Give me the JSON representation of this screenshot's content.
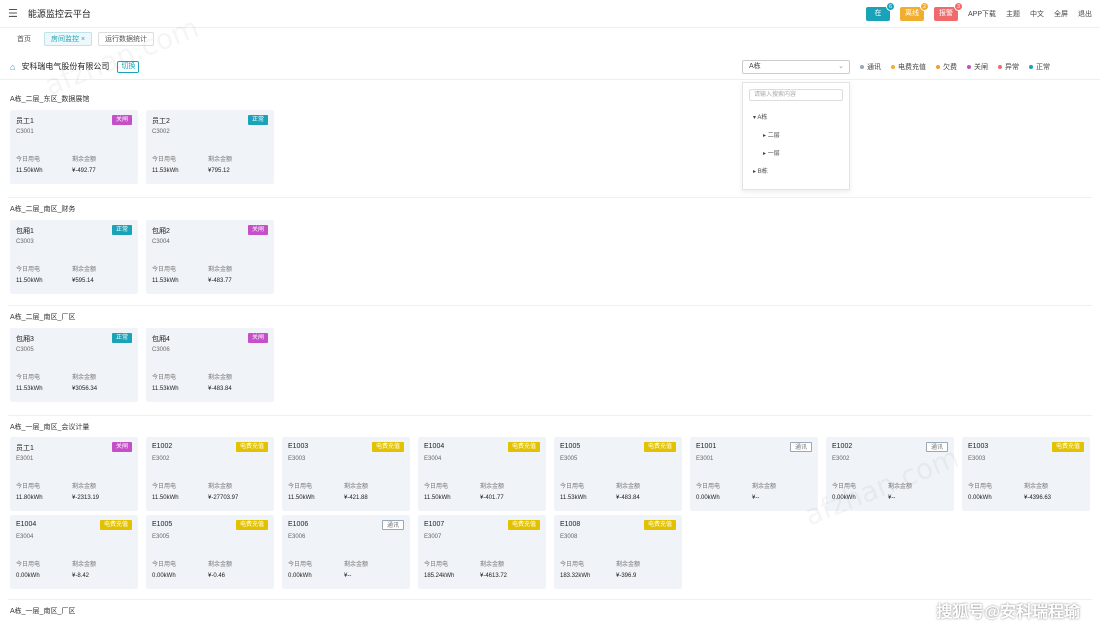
{
  "header": {
    "menu_icon": "menu-icon",
    "title": "能源监控云平台",
    "pills": [
      {
        "label": "在",
        "count": "6",
        "color": "#1aa3b8"
      },
      {
        "label": "离线",
        "count": "2",
        "color": "#f0ad2e"
      },
      {
        "label": "报警",
        "count": "3",
        "color": "#ef6b6b"
      }
    ],
    "links": [
      "APP下载",
      "主题",
      "中文",
      "全屏",
      "退出"
    ]
  },
  "tabs": [
    {
      "label": "首页",
      "state": "normal"
    },
    {
      "label": "房间监控 ×",
      "state": "active"
    },
    {
      "label": "运行数据统计",
      "state": "outline"
    }
  ],
  "company": {
    "name": "安科瑞电气股份有限公司",
    "switch_label": "切换",
    "select_value": "A栋",
    "legend": [
      {
        "label": "通讯",
        "color": "#9aa7b4"
      },
      {
        "label": "电费充值",
        "color": "#f0ad2e"
      },
      {
        "label": "欠费",
        "color": "#f39c34"
      },
      {
        "label": "关闸",
        "color": "#c44fc8"
      },
      {
        "label": "异常",
        "color": "#ef6b6b"
      },
      {
        "label": "正常",
        "color": "#1aa3b8"
      }
    ]
  },
  "dropdown": {
    "search_placeholder": "请输入搜索内容",
    "nodes": [
      {
        "label": "A栋",
        "level": 1
      },
      {
        "label": "二层",
        "level": 2
      },
      {
        "label": "一层",
        "level": 2
      },
      {
        "label": "B栋",
        "level": 1
      }
    ]
  },
  "groups": [
    {
      "title": "A栋_二层_东区_数据展馆",
      "cards": [
        {
          "name": "员工1",
          "code": "C3001",
          "badge": "关闸",
          "badge_color": "#c44fc8",
          "l1": "今日用电",
          "l2": "剩余金额",
          "v1": "11.50kWh",
          "v2": "¥-492.77"
        },
        {
          "name": "员工2",
          "code": "C3002",
          "badge": "正常",
          "badge_color": "#1aa3b8",
          "l1": "今日用电",
          "l2": "剩余金额",
          "v1": "11.53kWh",
          "v2": "¥795.12"
        }
      ]
    },
    {
      "title": "A栋_二层_南区_财务",
      "cards": [
        {
          "name": "包厢1",
          "code": "C3003",
          "badge": "正常",
          "badge_color": "#1aa3b8",
          "l1": "今日用电",
          "l2": "剩余金额",
          "v1": "11.50kWh",
          "v2": "¥595.14"
        },
        {
          "name": "包厢2",
          "code": "C3004",
          "badge": "关闸",
          "badge_color": "#c44fc8",
          "l1": "今日用电",
          "l2": "剩余金额",
          "v1": "11.53kWh",
          "v2": "¥-483.77"
        }
      ]
    },
    {
      "title": "A栋_二层_南区_厂区",
      "cards": [
        {
          "name": "包厢3",
          "code": "C3005",
          "badge": "正常",
          "badge_color": "#1aa3b8",
          "l1": "今日用电",
          "l2": "剩余金额",
          "v1": "11.53kWh",
          "v2": "¥3056.34"
        },
        {
          "name": "包厢4",
          "code": "C3006",
          "badge": "关闸",
          "badge_color": "#c44fc8",
          "l1": "今日用电",
          "l2": "剩余金额",
          "v1": "11.53kWh",
          "v2": "¥-483.84"
        }
      ]
    },
    {
      "title": "A栋_一层_南区_会议计量",
      "cards": [
        {
          "name": "员工1",
          "code": "E3001",
          "badge": "关闸",
          "badge_color": "#c44fc8",
          "l1": "今日用电",
          "l2": "剩余金额",
          "v1": "11.80kWh",
          "v2": "¥-2313.19"
        },
        {
          "name": "E1002",
          "code": "E3002",
          "badge": "电费充值",
          "badge_color": "#e2c200",
          "l1": "今日用电",
          "l2": "剩余金额",
          "v1": "11.50kWh",
          "v2": "¥-27703.97"
        },
        {
          "name": "E1003",
          "code": "E3003",
          "badge": "电费充值",
          "badge_color": "#e2c200",
          "l1": "今日用电",
          "l2": "剩余金额",
          "v1": "11.50kWh",
          "v2": "¥-421.88"
        },
        {
          "name": "E1004",
          "code": "E3004",
          "badge": "电费充值",
          "badge_color": "#e2c200",
          "l1": "今日用电",
          "l2": "剩余金额",
          "v1": "11.50kWh",
          "v2": "¥-401.77"
        },
        {
          "name": "E1005",
          "code": "E3005",
          "badge": "电费充值",
          "badge_color": "#e2c200",
          "l1": "今日用电",
          "l2": "剩余金额",
          "v1": "11.53kWh",
          "v2": "¥-483.84"
        },
        {
          "name": "E1001",
          "code": "E3001",
          "badge": "通讯",
          "badge_color": "#9aa7b4",
          "l1": "今日用电",
          "l2": "剩余金额",
          "v1": "0.00kWh",
          "v2": "¥--"
        },
        {
          "name": "E1002",
          "code": "E3002",
          "badge": "通讯",
          "badge_color": "#9aa7b4",
          "l1": "今日用电",
          "l2": "剩余金额",
          "v1": "0.00kWh",
          "v2": "¥--"
        },
        {
          "name": "E1003",
          "code": "E3003",
          "badge": "电费充值",
          "badge_color": "#e2c200",
          "l1": "今日用电",
          "l2": "剩余金额",
          "v1": "0.00kWh",
          "v2": "¥-4396.63"
        },
        {
          "name": "E1004",
          "code": "E3004",
          "badge": "电费充值",
          "badge_color": "#e2c200",
          "l1": "今日用电",
          "l2": "剩余金额",
          "v1": "0.00kWh",
          "v2": "¥-8.42"
        },
        {
          "name": "E1005",
          "code": "E3005",
          "badge": "电费充值",
          "badge_color": "#e2c200",
          "l1": "今日用电",
          "l2": "剩余金额",
          "v1": "0.00kWh",
          "v2": "¥-0.46"
        },
        {
          "name": "E1006",
          "code": "E3006",
          "badge": "通讯",
          "badge_color": "#9aa7b4",
          "l1": "今日用电",
          "l2": "剩余金额",
          "v1": "0.00kWh",
          "v2": "¥--"
        },
        {
          "name": "E1007",
          "code": "E3007",
          "badge": "电费充值",
          "badge_color": "#e2c200",
          "l1": "今日用电",
          "l2": "剩余金额",
          "v1": "185.24kWh",
          "v2": "¥-4613.72"
        },
        {
          "name": "E1008",
          "code": "E3008",
          "badge": "电费充值",
          "badge_color": "#e2c200",
          "l1": "今日用电",
          "l2": "剩余金额",
          "v1": "183.32kWh",
          "v2": "¥-396.9"
        }
      ]
    },
    {
      "title": "A栋_一层_南区_厂区",
      "cards": []
    }
  ],
  "overlay": {
    "source_tag": "搜狐号@安科瑞程瑜"
  }
}
